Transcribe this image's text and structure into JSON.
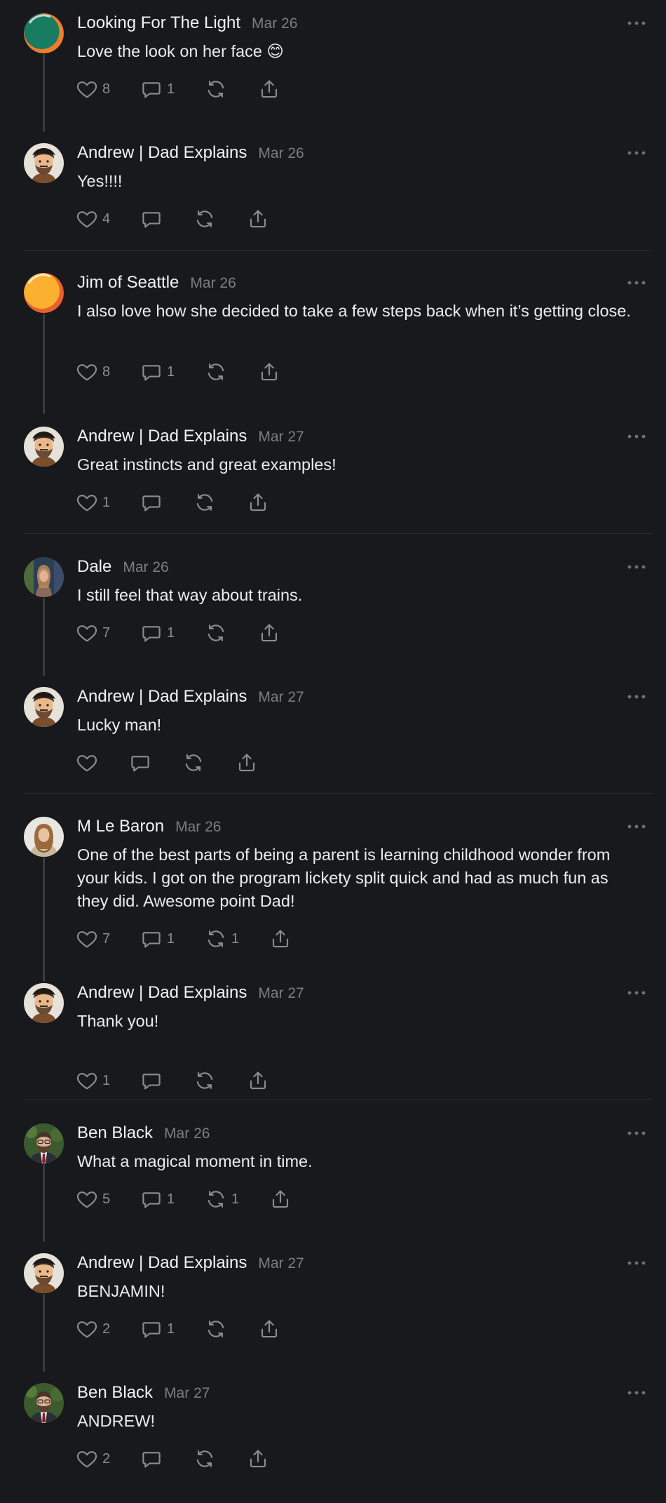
{
  "icons": {
    "like": "heart-icon",
    "reply": "comment-icon",
    "repost": "repost-icon",
    "share": "share-icon",
    "more": "more-options-icon"
  },
  "posts": [
    {
      "author": "Looking For The Light",
      "date": "Mar 26",
      "text": "Love the look on her face 😊",
      "likes": "8",
      "replies": "1",
      "reposts": "",
      "avatar": "teal-orange"
    },
    {
      "author": "Andrew | Dad Explains",
      "date": "Mar 26",
      "text": "Yes!!!!",
      "likes": "4",
      "replies": "",
      "reposts": "",
      "avatar": "andrew"
    },
    {
      "author": "Jim of Seattle",
      "date": "Mar 26",
      "text": "I also love how she decided to take a few steps back when it’s getting close.",
      "likes": "8",
      "replies": "1",
      "reposts": "",
      "avatar": "yellow-orange"
    },
    {
      "author": "Andrew | Dad Explains",
      "date": "Mar 27",
      "text": "Great instincts and great examples!",
      "likes": "1",
      "replies": "",
      "reposts": "",
      "avatar": "andrew"
    },
    {
      "author": "Dale",
      "date": "Mar 26",
      "text": "I still feel that way about trains.",
      "likes": "7",
      "replies": "1",
      "reposts": "",
      "avatar": "dale"
    },
    {
      "author": "Andrew | Dad Explains",
      "date": "Mar 27",
      "text": "Lucky man!",
      "likes": "",
      "replies": "",
      "reposts": "",
      "avatar": "andrew"
    },
    {
      "author": "M Le Baron",
      "date": "Mar 26",
      "text": "One of the best parts of being a parent is learning childhood wonder from your kids. I got on the program lickety split quick and had as much fun as they did. Awesome point Dad!",
      "likes": "7",
      "replies": "1",
      "reposts": "1",
      "avatar": "lebaron"
    },
    {
      "author": "Andrew | Dad Explains",
      "date": "Mar 27",
      "text": "Thank you!",
      "likes": "1",
      "replies": "",
      "reposts": "",
      "avatar": "andrew"
    },
    {
      "author": "Ben Black",
      "date": "Mar 26",
      "text": "What a magical moment in time.",
      "likes": "5",
      "replies": "1",
      "reposts": "1",
      "avatar": "ben"
    },
    {
      "author": "Andrew | Dad Explains",
      "date": "Mar 27",
      "text": "BENJAMIN!",
      "likes": "2",
      "replies": "1",
      "reposts": "",
      "avatar": "andrew"
    },
    {
      "author": "Ben Black",
      "date": "Mar 27",
      "text": "ANDREW!",
      "likes": "2",
      "replies": "",
      "reposts": "",
      "avatar": "ben"
    }
  ]
}
